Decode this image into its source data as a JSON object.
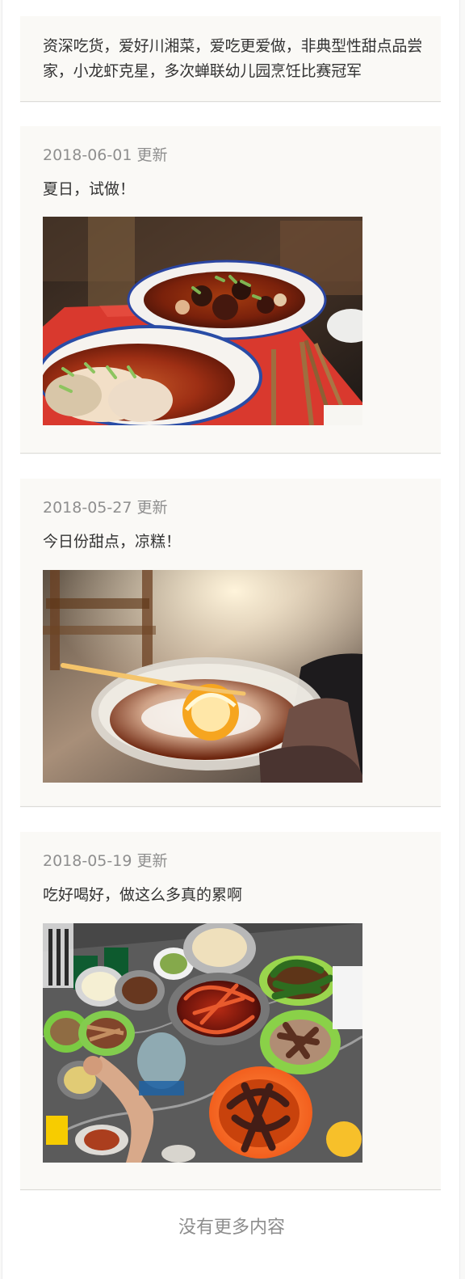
{
  "intro": {
    "text": "资深吃货，爱好川湘菜，爱吃更爱做，非典型性甜点品尝家，小龙虾克星，多次蝉联幼儿园烹饪比赛冠军"
  },
  "posts": [
    {
      "date": "2018-06-01 更新",
      "text": "夏日，试做！",
      "image_label": "food-photo-noodles"
    },
    {
      "date": "2018-05-27 更新",
      "text": "今日份甜点，凉糕！",
      "image_label": "food-photo-dessert"
    },
    {
      "date": "2018-05-19 更新",
      "text": "吃好喝好，做这么多真的累啊",
      "image_label": "food-photo-feast"
    }
  ],
  "footer": {
    "text": "没有更多内容"
  },
  "colors": {
    "background": "#f8f8f7",
    "card": "#faf9f6",
    "text": "#333333",
    "muted_text": "#8f8f8f"
  }
}
